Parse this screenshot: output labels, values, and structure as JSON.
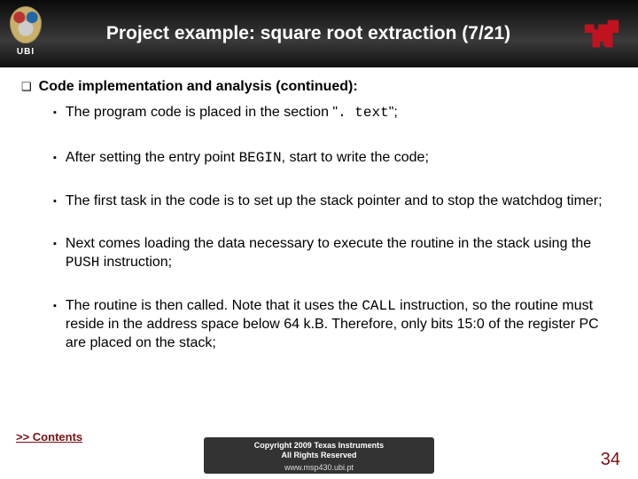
{
  "header": {
    "ubi_label": "UBI",
    "title": "Project example: square root extraction (7/21)"
  },
  "content": {
    "heading": "Code implementation and analysis (continued):",
    "bullets": [
      {
        "pre": "The program code is placed in the section \"",
        "code": ". text",
        "post": "\";"
      },
      {
        "pre": "After setting the entry point ",
        "code": "BEGIN",
        "post": ", start to write the code;"
      },
      {
        "pre": "The first task in the code is to set up the stack pointer and to stop the watchdog timer;",
        "code": "",
        "post": ""
      },
      {
        "pre": "Next comes loading the data necessary to execute the routine in the stack using the ",
        "code": "PUSH",
        "post": " instruction;"
      },
      {
        "pre": "The routine is then called. Note that it uses the ",
        "code": "CALL",
        "post": " instruction, so the routine must reside in the address space below 64 k.B. Therefore, only bits 15:0 of the register PC are placed on the stack;"
      }
    ]
  },
  "footer": {
    "contents_link": ">> Contents",
    "copyright_line1": "Copyright 2009 Texas Instruments",
    "copyright_line2": "All Rights Reserved",
    "site": "www.msp430.ubi.pt",
    "page_number": "34"
  }
}
